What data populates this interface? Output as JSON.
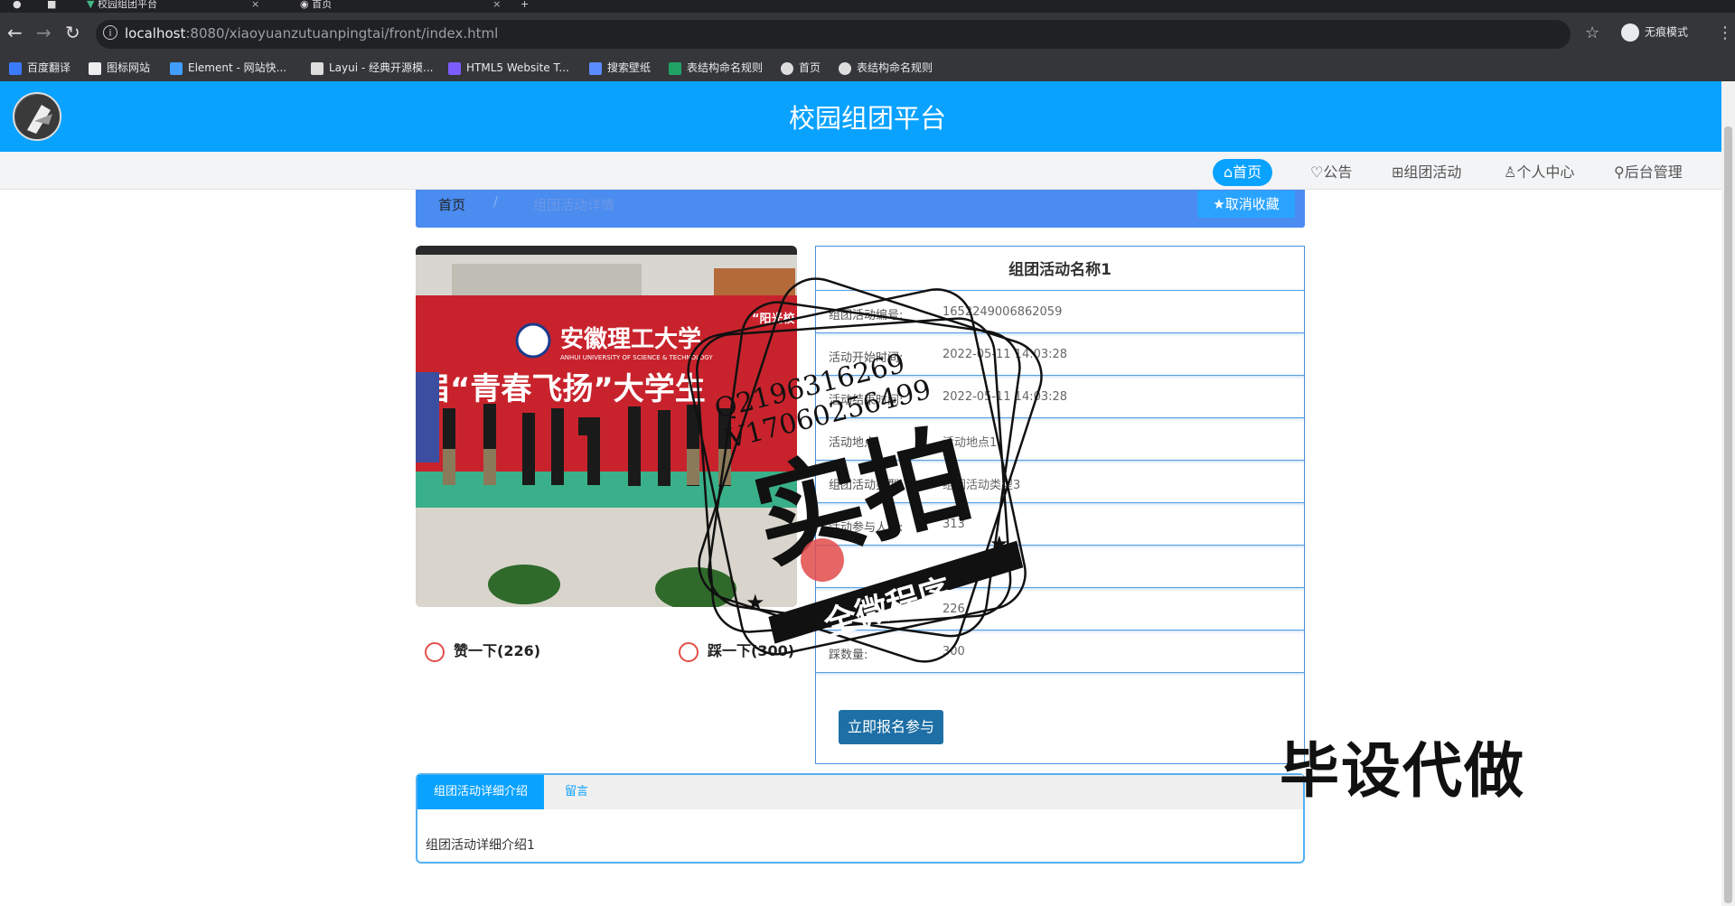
{
  "browser": {
    "tabs": [
      {
        "label": "校园组团平台"
      },
      {
        "label": "首页"
      }
    ],
    "url_host": "localhost",
    "url_rest": ":8080/xiaoyuanzutuanpingtai/front/index.html",
    "incognito_label": "无痕模式",
    "bookmarks": [
      {
        "label": "百度翻译",
        "color": "#3a7bfd"
      },
      {
        "label": "图标网站",
        "color": "#eeeeee"
      },
      {
        "label": "Element - 网站快...",
        "color": "#409eff"
      },
      {
        "label": "Layui - 经典开源模...",
        "color": "#dddddd"
      },
      {
        "label": "HTML5 Website T...",
        "color": "#7c5cff"
      },
      {
        "label": "搜索壁纸",
        "color": "#5b8cff"
      },
      {
        "label": "表结构命名规则",
        "color": "#21a366"
      },
      {
        "label": "首页",
        "color": "#dddddd"
      },
      {
        "label": "表结构命名规则",
        "color": "#dddddd"
      }
    ]
  },
  "header": {
    "title": "校园组团平台"
  },
  "nav": {
    "home": "⌂首页",
    "notice": "♡公告",
    "activity": "⊞组团活动",
    "profile": "♙个人中心",
    "admin": "⚲后台管理"
  },
  "breadcrumb": {
    "home": "首页",
    "sep": "/",
    "current": "组团活动详情",
    "unfav": "★取消收藏"
  },
  "photo": {
    "banner_school": "安徽理工大学",
    "banner_slogan": "届“青春飞扬”大学生",
    "banner_sub": "ANHUI UNIVERSITY OF SCIENCE & TECHNOLOGY",
    "banner_corner": "“阳光校"
  },
  "votes": {
    "like": "赞一下(226)",
    "dislike": "踩一下(300)"
  },
  "detail": {
    "title": "组团活动名称1",
    "rows": [
      {
        "label": "组团活动编号:",
        "value": "1652249006862059"
      },
      {
        "label": "活动开始时间:",
        "value": "2022-05-11 14:03:28"
      },
      {
        "label": "活动结束时间:",
        "value": "2022-05-11 14:03:28"
      },
      {
        "label": "活动地点:",
        "value": "活动地点1"
      },
      {
        "label": "组团活动类型:",
        "value": "组团活动类型3"
      },
      {
        "label": "活动参与人数:",
        "value": "313"
      },
      {
        "label": "",
        "value": ""
      },
      {
        "label": "赞数量:",
        "value": "226"
      },
      {
        "label": "踩数量:",
        "value": "300"
      }
    ],
    "signup": "立即报名参与"
  },
  "tabs": {
    "intro": "组团活动详细介绍",
    "message": "留言",
    "intro_text": "组团活动详细介绍1"
  },
  "watermark": {
    "qq": "Q2196316269",
    "vx": "V17060256499",
    "big": "实拍",
    "ribbon": "全微程序",
    "bottom": "毕设代做"
  }
}
